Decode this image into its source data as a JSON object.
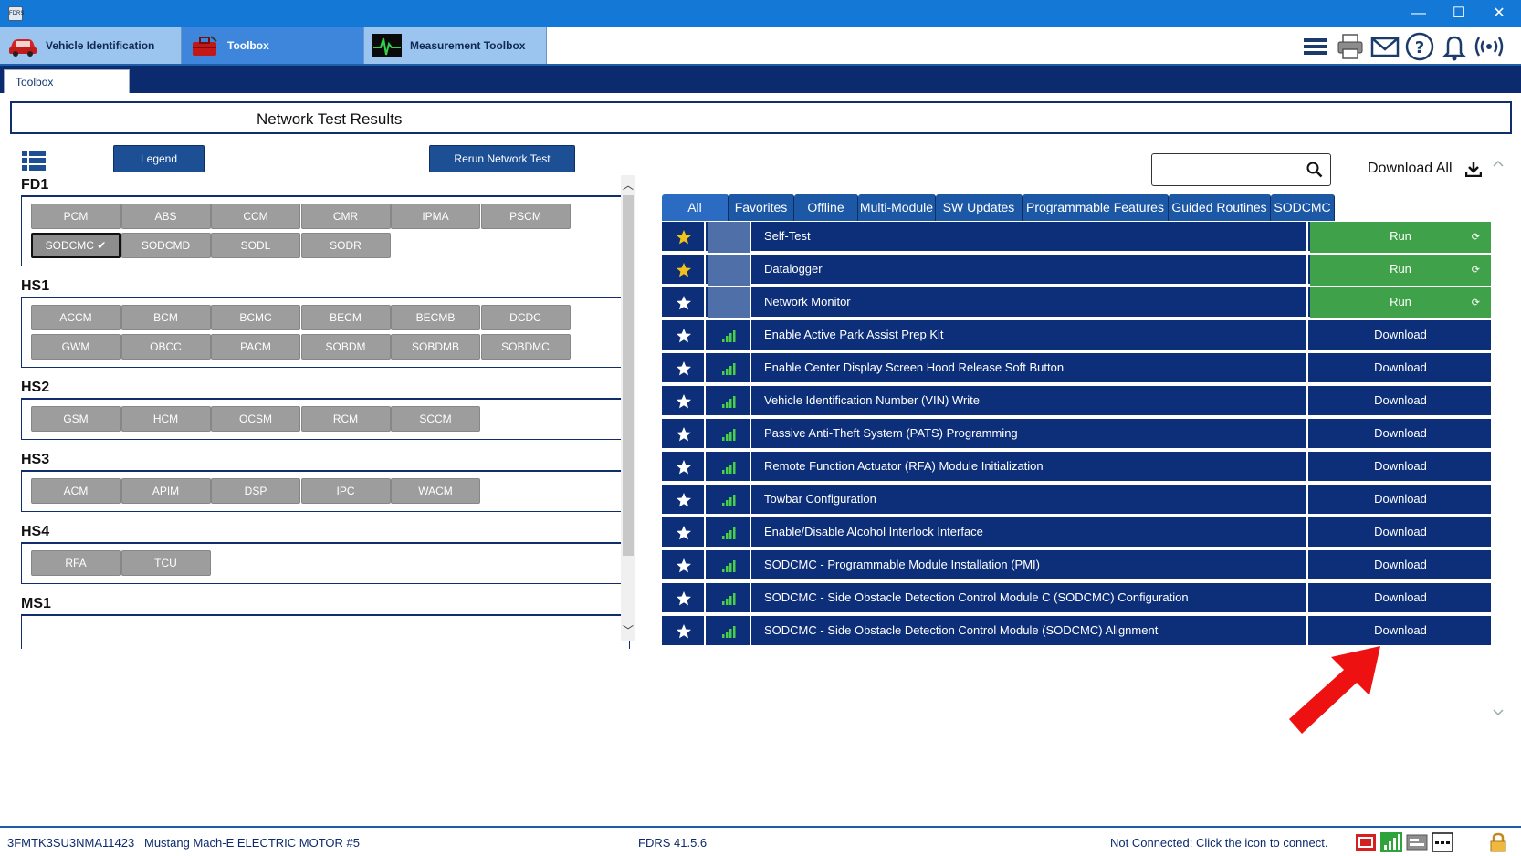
{
  "window": {
    "app_icon_text": "FDRS",
    "minimize_glyph": "—",
    "maximize_glyph": "☐",
    "close_glyph": "✕"
  },
  "main_tabs": [
    {
      "label": "Vehicle Identification",
      "icon": "car-icon"
    },
    {
      "label": "Toolbox",
      "icon": "toolbox-icon"
    },
    {
      "label": "Measurement Toolbox",
      "icon": "oscilloscope-icon"
    }
  ],
  "toolbar_icons": [
    "menu-icon",
    "printer-icon",
    "mail-icon",
    "help-icon",
    "bell-icon",
    "wireless-icon"
  ],
  "subtab": {
    "label": "Toolbox"
  },
  "header": {
    "title": "Network Test Results"
  },
  "left": {
    "legend_label": "Legend",
    "rerun_label": "Rerun Network Test",
    "networks": [
      {
        "name": "FD1",
        "modules": [
          "PCM",
          "ABS",
          "CCM",
          "CMR",
          "IPMA",
          "PSCM",
          "SODCMC",
          "SODCMD",
          "SODL",
          "SODR"
        ],
        "selected": "SODCMC"
      },
      {
        "name": "HS1",
        "modules": [
          "ACCM",
          "BCM",
          "BCMC",
          "BECM",
          "BECMB",
          "DCDC",
          "GWM",
          "OBCC",
          "PACM",
          "SOBDM",
          "SOBDMB",
          "SOBDMC"
        ]
      },
      {
        "name": "HS2",
        "modules": [
          "GSM",
          "HCM",
          "OCSM",
          "RCM",
          "SCCM"
        ]
      },
      {
        "name": "HS3",
        "modules": [
          "ACM",
          "APIM",
          "DSP",
          "IPC",
          "WACM"
        ]
      },
      {
        "name": "HS4",
        "modules": [
          "RFA",
          "TCU"
        ]
      },
      {
        "name": "MS1",
        "modules": []
      }
    ]
  },
  "right": {
    "search_placeholder": "",
    "download_all_label": "Download All",
    "filter_tabs": [
      "All",
      "Favorites",
      "Offline",
      "Multi-Module",
      "SW Updates",
      "Programmable Features",
      "Guided Routines",
      "SODCMC"
    ],
    "active_filter": "All",
    "tools": [
      {
        "name": "Self-Test",
        "action": "Run",
        "fav": true,
        "signal": false
      },
      {
        "name": "Datalogger",
        "action": "Run",
        "fav": true,
        "signal": false
      },
      {
        "name": "Network Monitor",
        "action": "Run",
        "fav": false,
        "signal": false
      },
      {
        "name": "Enable Active Park Assist Prep Kit",
        "action": "Download",
        "fav": false,
        "signal": true
      },
      {
        "name": "Enable Center Display Screen Hood Release Soft Button",
        "action": "Download",
        "fav": false,
        "signal": true
      },
      {
        "name": "Vehicle Identification Number (VIN) Write",
        "action": "Download",
        "fav": false,
        "signal": true
      },
      {
        "name": "Passive Anti-Theft System (PATS) Programming",
        "action": "Download",
        "fav": false,
        "signal": true
      },
      {
        "name": "Remote Function Actuator (RFA) Module Initialization",
        "action": "Download",
        "fav": false,
        "signal": true
      },
      {
        "name": "Towbar Configuration",
        "action": "Download",
        "fav": false,
        "signal": true
      },
      {
        "name": "Enable/Disable Alcohol Interlock Interface",
        "action": "Download",
        "fav": false,
        "signal": true
      },
      {
        "name": "SODCMC - Programmable Module Installation (PMI)",
        "action": "Download",
        "fav": false,
        "signal": true
      },
      {
        "name": "SODCMC - Side Obstacle Detection Control Module C (SODCMC) Configuration",
        "action": "Download",
        "fav": false,
        "signal": true
      },
      {
        "name": "SODCMC - Side Obstacle Detection Control Module (SODCMC) Alignment",
        "action": "Download",
        "fav": false,
        "signal": true
      }
    ]
  },
  "status": {
    "vin": "3FMTK3SU3NMA11423",
    "vehicle": "Mustang Mach-E ELECTRIC MOTOR #5",
    "version": "FDRS 41.5.6",
    "connection": "Not Connected: Click the icon to connect."
  },
  "colors": {
    "title_bar": "#1378d6",
    "navy": "#0d2f7a",
    "run_green": "#3fa24a",
    "module_gray": "#9d9d9d",
    "arrow_red": "#ee1111"
  }
}
